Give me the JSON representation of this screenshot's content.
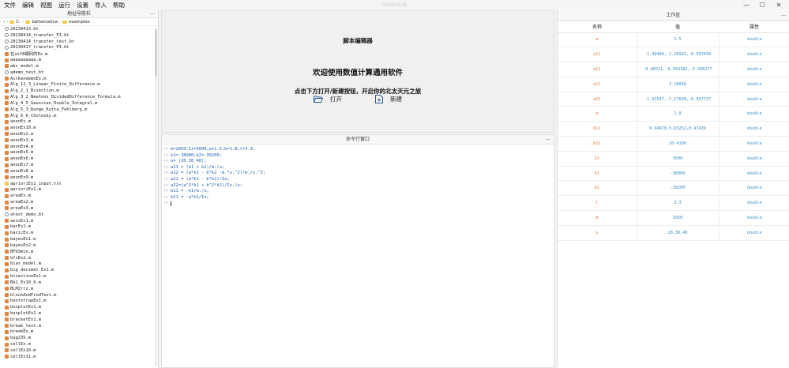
{
  "window": {
    "title": "Untitled.bt",
    "minimize": "—",
    "maximize": "☐",
    "close": "✕"
  },
  "menu": [
    "文件",
    "编辑",
    "视图",
    "运行",
    "设置",
    "导入",
    "帮助"
  ],
  "file_nav": {
    "title": "地址导航栏",
    "breadcrumb": [
      "C:",
      "baltamatica",
      "examples"
    ],
    "files": [
      {
        "name": "20230413.bt",
        "type": "bt"
      },
      {
        "name": "20230414_transfer_PI.bt",
        "type": "bt"
      },
      {
        "name": "20230414_transfer_test.bt",
        "type": "bt"
      },
      {
        "name": "20230417_transfer_PI.bt",
        "type": "bt"
      },
      {
        "name": "在utf8编码的Ex.m",
        "type": "m"
      },
      {
        "name": "aaaaaaaaaa.m",
        "type": "m"
      },
      {
        "name": "abc_model.m",
        "type": "m"
      },
      {
        "name": "ademo_test.bt",
        "type": "bt"
      },
      {
        "name": "AitkendemoEx.m",
        "type": "m"
      },
      {
        "name": "Alg_11_3_Linear_Finite_Difference.m",
        "type": "m"
      },
      {
        "name": "Alg_2_1_Bisection.m",
        "type": "m"
      },
      {
        "name": "Alg_3_2_Newtons_DividedDifference_Formula.m",
        "type": "m"
      },
      {
        "name": "Alg_4_5_Gaussian_Double_Integral.m",
        "type": "m"
      },
      {
        "name": "Alg_5_3_Runge_Kutta_Fehlberg.m",
        "type": "m"
      },
      {
        "name": "Alg_6_6_Cholesky.m",
        "type": "m"
      },
      {
        "name": "anonEx.m",
        "type": "m"
      },
      {
        "name": "anonEx10.m",
        "type": "m"
      },
      {
        "name": "anonEx2.m",
        "type": "m"
      },
      {
        "name": "anonEx3.m",
        "type": "m"
      },
      {
        "name": "anonEx4.m",
        "type": "m"
      },
      {
        "name": "anonEx5.m",
        "type": "m"
      },
      {
        "name": "anonEx6.m",
        "type": "m"
      },
      {
        "name": "anonEx7.m",
        "type": "m"
      },
      {
        "name": "anonEx8.m",
        "type": "m"
      },
      {
        "name": "anonEx9.m",
        "type": "m"
      },
      {
        "name": "aprioriEx1_input.txt",
        "type": "txt"
      },
      {
        "name": "aprioriEx1.m",
        "type": "m"
      },
      {
        "name": "areaEx.m",
        "type": "m"
      },
      {
        "name": "areaEx2.m",
        "type": "m"
      },
      {
        "name": "areaEx3.m",
        "type": "m"
      },
      {
        "name": "atest_demo.bt",
        "type": "bt"
      },
      {
        "name": "axisEx1.m",
        "type": "m"
      },
      {
        "name": "barEx1.m",
        "type": "m"
      },
      {
        "name": "basicEx.m",
        "type": "m"
      },
      {
        "name": "bayesEx1.m",
        "type": "m"
      },
      {
        "name": "bayesEx2.m",
        "type": "m"
      },
      {
        "name": "BFGSmin.m",
        "type": "m"
      },
      {
        "name": "bfsEx2.m",
        "type": "m"
      },
      {
        "name": "bias_model.m",
        "type": "m"
      },
      {
        "name": "big_decimal_Ex1.m",
        "type": "m"
      },
      {
        "name": "bisectionEx1.m",
        "type": "m"
      },
      {
        "name": "Bk2_Ex10_6.m",
        "type": "m"
      },
      {
        "name": "BLMZrrz.m",
        "type": "m"
      },
      {
        "name": "blockAndFindTest.m",
        "type": "m"
      },
      {
        "name": "bootstrapEx1.m",
        "type": "m"
      },
      {
        "name": "boxplotEx1.m",
        "type": "m"
      },
      {
        "name": "boxplotEx2.m",
        "type": "m"
      },
      {
        "name": "bracketEx1.m",
        "type": "m"
      },
      {
        "name": "break_test.m",
        "type": "m"
      },
      {
        "name": "breakEx.m",
        "type": "m"
      },
      {
        "name": "bug235.m",
        "type": "m"
      },
      {
        "name": "cellEx.m",
        "type": "m"
      },
      {
        "name": "cellEx10.m",
        "type": "m"
      },
      {
        "name": "cellEx11.m",
        "type": "m"
      }
    ]
  },
  "editor": {
    "title": "脚本编辑器",
    "welcome": "欢迎使用数值计算通用软件",
    "subtitle": "点击下方打开/新建按钮，开启你的北太天元之旅",
    "open_label": "打开",
    "new_label": "新建"
  },
  "command_window": {
    "title": "命令行窗口",
    "prompt": ">>",
    "lines": [
      "m=2050;Iz=5600;a=1.5;b=1.8;l=3.3;",
      "k1=-38900;k2=-39200;",
      "u= [20 30 40];",
      "a11 = (k1 + k2)/m./u;",
      "a12 = (a*k1 - b*k2 -m.*u.^2)/m./u.^2;",
      "a21 = (a*k1 - b*k2)/Iz;",
      "a22=(a^2*k1 + b^2*k2)/Iz./u;",
      "b11 = -k1/m./u;",
      "b21 = -a*k1/Iz;",
      ""
    ]
  },
  "workspace": {
    "title": "工作区",
    "columns": [
      "名称",
      "值",
      "属性"
    ],
    "rows": [
      {
        "name": "a",
        "value": "1.5",
        "type": "double"
      },
      {
        "name": "a11",
        "value": "-1.90488,-1.26992,-0.952439",
        "type": "double"
      },
      {
        "name": "a12",
        "value": "-0.98511,-0.993382,-0.996277",
        "type": "double"
      },
      {
        "name": "a21",
        "value": "2.18036",
        "type": "double"
      },
      {
        "name": "a22",
        "value": "-1.91547,-1.27698,-0.957737",
        "type": "double"
      },
      {
        "name": "b",
        "value": "1.8",
        "type": "double"
      },
      {
        "name": "b11",
        "value": "0.94878,0.63252,0.47439",
        "type": "double"
      },
      {
        "name": "b21",
        "value": "10.4196",
        "type": "double"
      },
      {
        "name": "Iz",
        "value": "5600",
        "type": "double"
      },
      {
        "name": "k1",
        "value": "-38900",
        "type": "double"
      },
      {
        "name": "k2",
        "value": "-39200",
        "type": "double"
      },
      {
        "name": "l",
        "value": "3.3",
        "type": "double"
      },
      {
        "name": "m",
        "value": "2050",
        "type": "double"
      },
      {
        "name": "u",
        "value": "20,30,40",
        "type": "double"
      }
    ]
  },
  "colors": {
    "variable_name": "#e07b3c",
    "value": "#3a8fc8",
    "code": "#1f5fb0",
    "m_file_icon": "#e8833a",
    "txt_file_icon": "#f2c94c"
  }
}
